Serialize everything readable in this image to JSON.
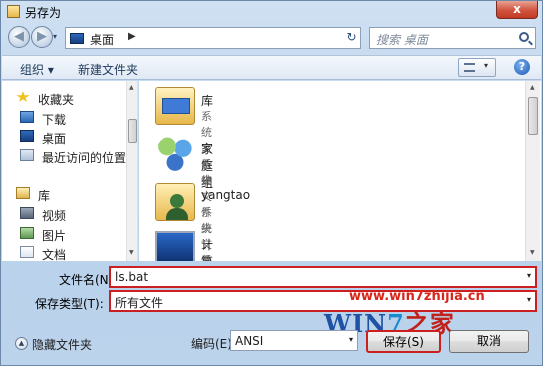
{
  "window": {
    "title": "另存为",
    "close_label": "x"
  },
  "nav": {
    "back_glyph": "◀",
    "forward_glyph": "▶",
    "history_glyph": "▾",
    "address": {
      "location": "桌面",
      "separator": "▶",
      "dropdown_glyph": "▾",
      "refresh_glyph": "↻"
    },
    "search": {
      "placeholder": "搜索 桌面"
    }
  },
  "toolbar": {
    "organize": "组织 ▾",
    "new_folder": "新建文件夹",
    "view_dropdown": "▾",
    "help": "?"
  },
  "sidebar": {
    "groups": [
      {
        "label": "收藏夹",
        "icon": "favorites-star-icon",
        "items": [
          {
            "label": "下载",
            "icon": "downloads-icon"
          },
          {
            "label": "桌面",
            "icon": "desktop-icon"
          },
          {
            "label": "最近访问的位置",
            "icon": "recent-places-icon"
          }
        ]
      },
      {
        "label": "库",
        "icon": "libraries-icon",
        "items": [
          {
            "label": "视频",
            "icon": "videos-icon"
          },
          {
            "label": "图片",
            "icon": "pictures-icon"
          },
          {
            "label": "文档",
            "icon": "documents-icon"
          }
        ]
      }
    ]
  },
  "files": [
    {
      "name": "库",
      "type": "系统文件夹",
      "icon": "library-folder-icon"
    },
    {
      "name": "家庭组",
      "type": "系统文件夹",
      "icon": "homegroup-icon"
    },
    {
      "name": "yangtao",
      "type": "系统文件夹",
      "icon": "user-folder-icon"
    },
    {
      "name": "计算机",
      "type": "系统文件夹",
      "icon": "computer-icon"
    }
  ],
  "form": {
    "filename_label": "文件名(N):",
    "filename_value": "ls.bat",
    "filetype_label": "保存类型(T):",
    "filetype_value": "所有文件",
    "encoding_label": "编码(E):",
    "encoding_value": "ANSI",
    "dropdown_glyph": "▾"
  },
  "footer": {
    "hide_folders": "隐藏文件夹",
    "hide_glyph": "▲",
    "save": "保存(S)",
    "cancel": "取消"
  },
  "watermark": {
    "url": "www.win7zhijia.cn",
    "logo_part1": "WIN",
    "logo_part2": "7",
    "logo_part3": "之家"
  },
  "colors": {
    "highlight": "#cc1f1f",
    "accent": "#1f52a5"
  }
}
